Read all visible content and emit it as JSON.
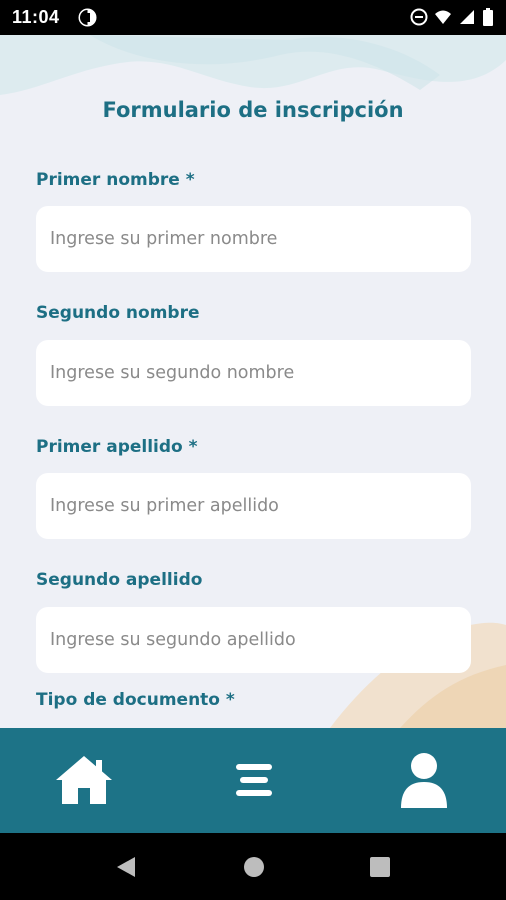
{
  "status_bar": {
    "time": "11:04",
    "icons": [
      "app-notification-icon",
      "do-not-disturb-icon",
      "wifi-icon",
      "signal-icon",
      "battery-icon"
    ]
  },
  "form": {
    "title": "Formulario de inscripción",
    "fields": [
      {
        "label": "Primer nombre *",
        "placeholder": "Ingrese su primer nombre",
        "value": ""
      },
      {
        "label": "Segundo nombre",
        "placeholder": "Ingrese su segundo nombre",
        "value": ""
      },
      {
        "label": "Primer apellido *",
        "placeholder": "Ingrese su primer apellido",
        "value": ""
      },
      {
        "label": "Segundo apellido",
        "placeholder": "Ingrese su segundo apellido",
        "value": ""
      },
      {
        "label": "Tipo de documento *"
      }
    ]
  },
  "bottom_nav": {
    "items": [
      {
        "icon": "home-icon"
      },
      {
        "icon": "menu-icon"
      },
      {
        "icon": "user-profile-icon"
      }
    ]
  },
  "android_nav": {
    "items": [
      {
        "icon": "back-icon"
      },
      {
        "icon": "home-circle-icon"
      },
      {
        "icon": "recents-icon"
      }
    ]
  },
  "colors": {
    "accent": "#1d6f84",
    "nav_background": "#1d7387",
    "screen_background": "#eef0f6",
    "input_background": "#ffffff"
  }
}
